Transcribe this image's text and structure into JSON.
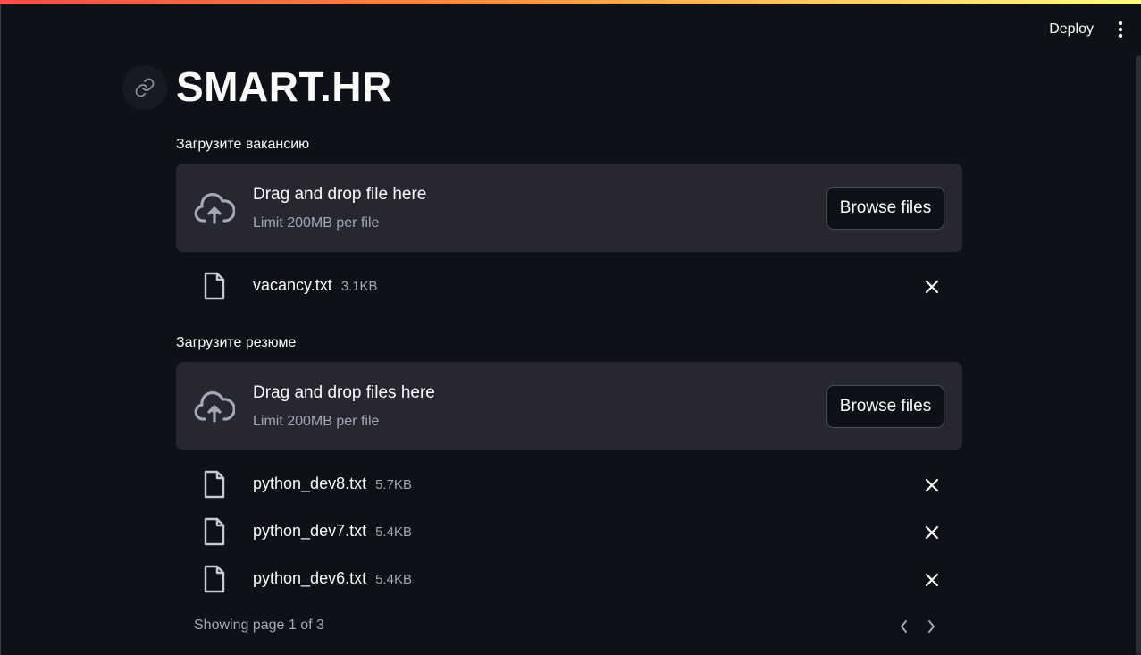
{
  "header": {
    "deploy_label": "Deploy",
    "menu_icon": "kebab-menu-icon"
  },
  "title": "SMART.HR",
  "vacancy_uploader": {
    "label": "Загрузите вакансию",
    "drop_title": "Drag and drop file here",
    "drop_limit": "Limit 200MB per file",
    "browse_label": "Browse files",
    "files": [
      {
        "name": "vacancy.txt",
        "size": "3.1KB"
      }
    ]
  },
  "resume_uploader": {
    "label": "Загрузите резюме",
    "drop_title": "Drag and drop files here",
    "drop_limit": "Limit 200MB per file",
    "browse_label": "Browse files",
    "files": [
      {
        "name": "python_dev8.txt",
        "size": "5.7KB"
      },
      {
        "name": "python_dev7.txt",
        "size": "5.4KB"
      },
      {
        "name": "python_dev6.txt",
        "size": "5.4KB"
      }
    ],
    "pagination": "Showing page 1 of 3"
  },
  "colors": {
    "background": "#0e1117",
    "panel": "#262730",
    "muted_text": "#a3a8b4"
  }
}
